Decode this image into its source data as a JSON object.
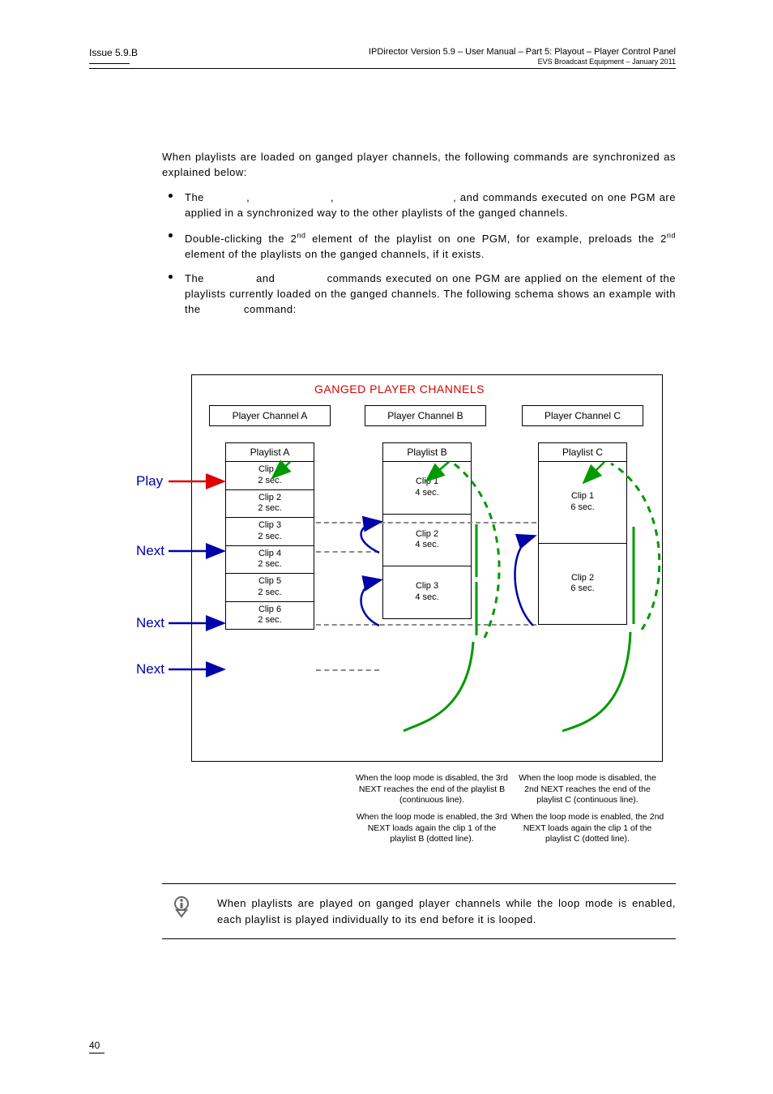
{
  "header": {
    "issue": "Issue 5.9.B",
    "title": "IPDirector Version 5.9 – User Manual – Part 5: Playout – Player Control Panel",
    "subtitle": "EVS Broadcast Equipment – January 2011"
  },
  "intro": "When playlists are loaded on ganged player channels, the following commands are synchronized as explained below:",
  "bullets": [
    {
      "pre": "The ",
      "gap1": "          ,                     ,                               ,",
      "mid": "                  and                  commands executed on one PGM are applied in a synchronized way to the other playlists of the ganged channels."
    },
    {
      "text_before_sup1": "Double-clicking the 2",
      "sup1": "nd",
      "text_mid": " element of the playlist on one PGM, for example, preloads the 2",
      "sup2": "nd",
      "text_after": " element of the playlists on the ganged channels, if it exists."
    },
    {
      "text": "The             and             commands executed on one PGM are applied on the element of the playlists currently loaded on the ganged channels. The following schema shows an example with the             command:"
    }
  ],
  "diagram": {
    "title": "GANGED PLAYER CHANNELS",
    "channelA": "Player Channel A",
    "channelB": "Player Channel B",
    "channelC": "Player Channel C",
    "playlistA": "Playlist A",
    "playlistB": "Playlist B",
    "playlistC": "Playlist C",
    "commands": {
      "play": "Play",
      "next": "Next"
    },
    "colA_clips": [
      {
        "name": "Clip 1",
        "dur": "2 sec."
      },
      {
        "name": "Clip 2",
        "dur": "2 sec."
      },
      {
        "name": "Clip 3",
        "dur": "2 sec."
      },
      {
        "name": "Clip 4",
        "dur": "2 sec."
      },
      {
        "name": "Clip 5",
        "dur": "2 sec."
      },
      {
        "name": "Clip 6",
        "dur": "2 sec."
      }
    ],
    "colB_clips": [
      {
        "name": "Clip 1",
        "dur": "4 sec."
      },
      {
        "name": "Clip 2",
        "dur": "4 sec."
      },
      {
        "name": "Clip 3",
        "dur": "4 sec."
      }
    ],
    "colC_clips": [
      {
        "name": "Clip 1",
        "dur": "6 sec."
      },
      {
        "name": "Clip 2",
        "dur": "6 sec."
      }
    ],
    "fn1a": "When the loop mode is disabled, the 3rd NEXT reaches the end of the playlist B (continuous line).",
    "fn1b": "When the loop mode is enabled, the 3rd NEXT loads again the clip 1 of the playlist B (dotted line).",
    "fn2a": "When the loop mode is disabled, the 2nd NEXT reaches the end of the playlist C (continuous line).",
    "fn2b": "When the loop mode is enabled, the 2nd NEXT loads again the clip 1 of the playlist C (dotted line)."
  },
  "note": "When playlists are played on ganged player channels while the loop mode is enabled, each playlist is played individually to its end before it is looped.",
  "page_number": "40"
}
